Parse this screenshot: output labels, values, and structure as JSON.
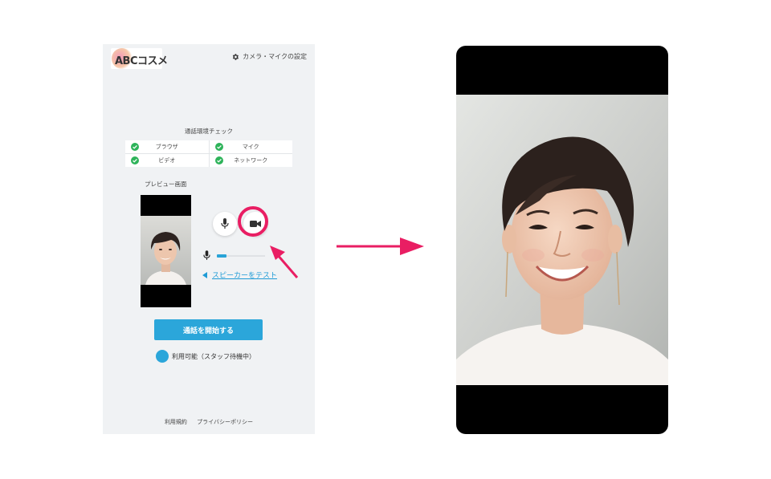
{
  "header": {
    "logo_text": "ABCコスメ",
    "settings_label": "カメラ・マイクの設定"
  },
  "check": {
    "title": "通話環境チェック",
    "items": [
      {
        "label": "ブラウザ",
        "status": "ok"
      },
      {
        "label": "マイク",
        "status": "ok"
      },
      {
        "label": "ビデオ",
        "status": "ok"
      },
      {
        "label": "ネットワーク",
        "status": "ok"
      }
    ]
  },
  "preview": {
    "title": "プレビュー画面"
  },
  "controls": {
    "mic_icon": "microphone-icon",
    "camera_icon": "video-camera-icon",
    "volume_level": 0.2,
    "speaker_test_label": "スピーカーをテスト"
  },
  "actions": {
    "start_call_label": "通話を開始する"
  },
  "status": {
    "text": "利用可能（スタッフ待機中）",
    "color": "#2ba6da"
  },
  "footer": {
    "terms_label": "利用規約",
    "privacy_label": "プライバシーポリシー"
  },
  "colors": {
    "accent": "#2ba6da",
    "highlight": "#e91e63",
    "check_ok": "#2eb35a"
  }
}
